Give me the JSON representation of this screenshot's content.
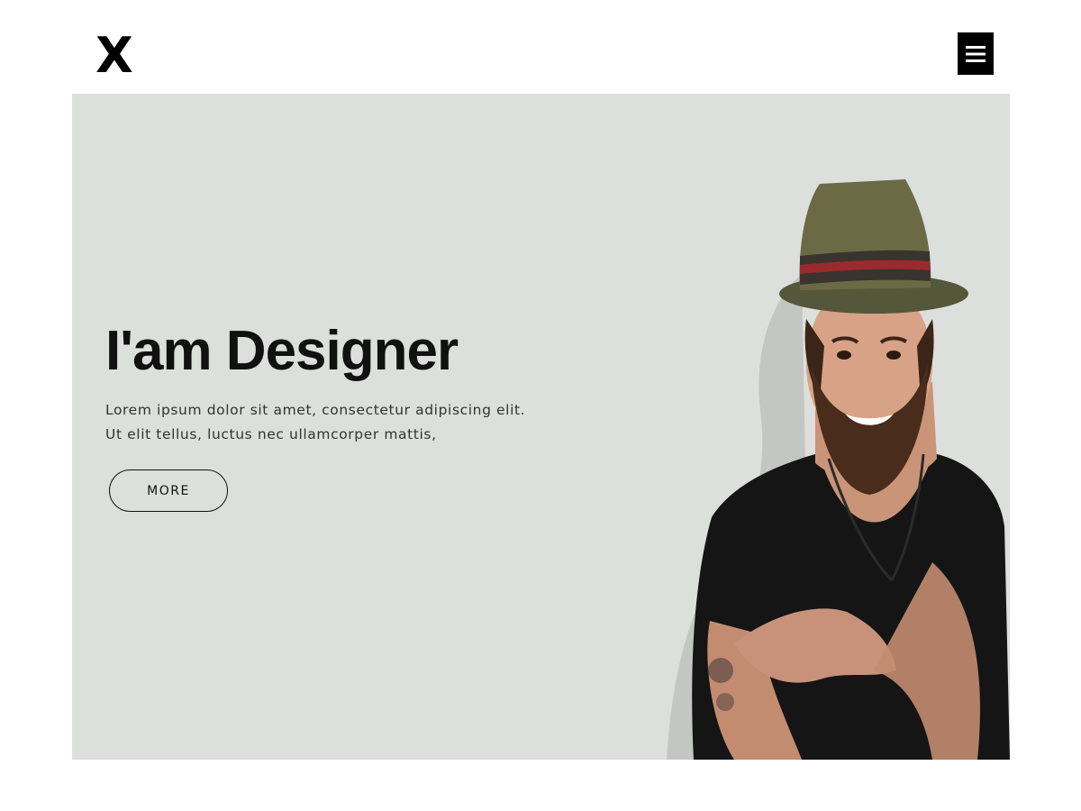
{
  "header": {
    "logo_text": "X",
    "menu_icon": "hamburger-menu-icon"
  },
  "hero": {
    "title": "I'am Designer",
    "description": "Lorem ipsum dolor sit amet, consectetur adipiscing elit. Ut elit tellus, luctus nec ullamcorper mattis,",
    "button_label": "MORE",
    "image": "portrait of smiling bearded man in hat and black t-shirt"
  },
  "colors": {
    "hero_background": "#dcdfdc",
    "text": "#111111",
    "menu_button": "#000000"
  }
}
